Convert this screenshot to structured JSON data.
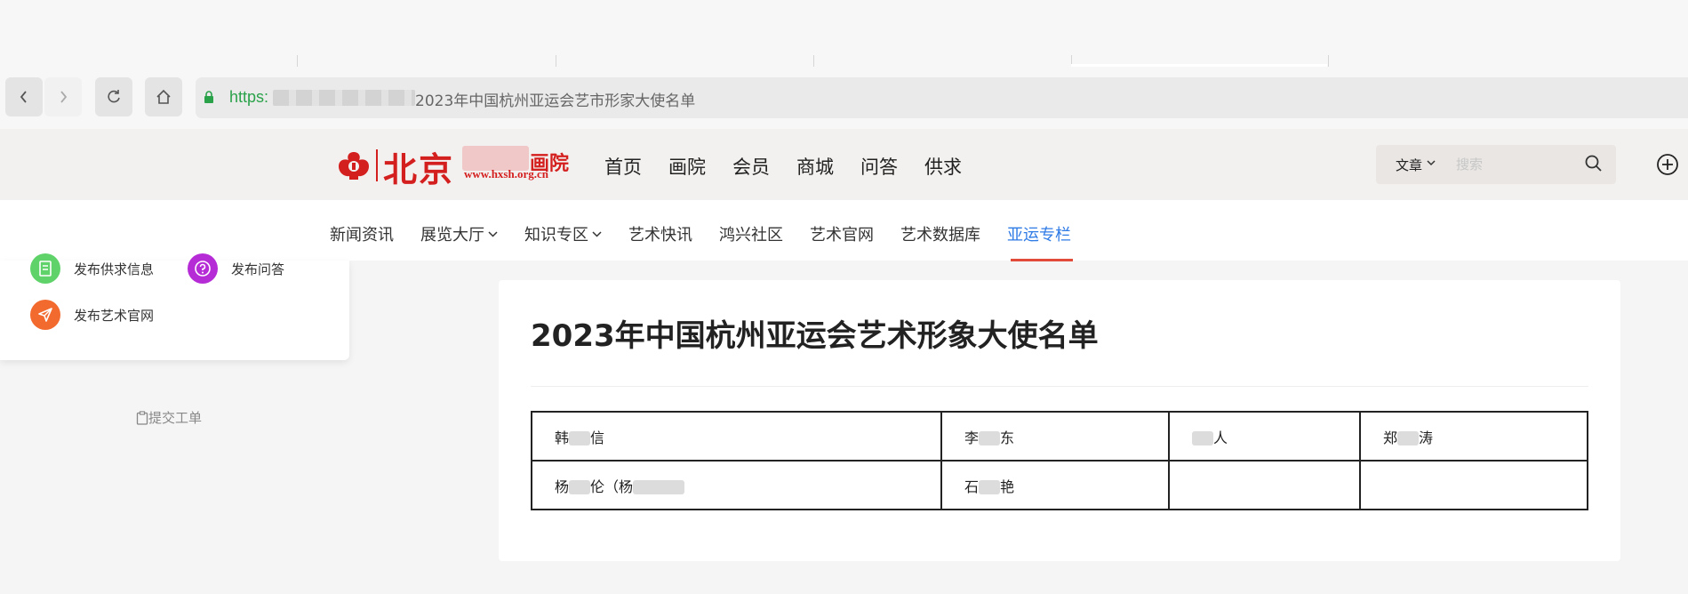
{
  "browser": {
    "url_scheme": "https:",
    "url_rest": "2023年中国杭州亚运会艺市形家大使名单",
    "back_icon": "chevron-left-icon",
    "forward_icon": "chevron-right-icon",
    "reload_icon": "reload-icon",
    "home_icon": "home-icon"
  },
  "site": {
    "logo_text": "北京",
    "logo_suffix": "画院",
    "logo_url": "www.hxsh.org.cn",
    "brand_color": "#d41f1f",
    "nav": [
      "首页",
      "画院",
      "会员",
      "商城",
      "问答",
      "供求"
    ],
    "search": {
      "type_label": "文章",
      "placeholder": "搜索"
    }
  },
  "subnav": {
    "items": [
      {
        "label": "新闻资讯",
        "has_caret": false
      },
      {
        "label": "展览大厅",
        "has_caret": true
      },
      {
        "label": "知识专区",
        "has_caret": true
      },
      {
        "label": "艺术快讯",
        "has_caret": false
      },
      {
        "label": "鸿兴社区",
        "has_caret": false
      },
      {
        "label": "艺术官网",
        "has_caret": false
      },
      {
        "label": "艺术数据库",
        "has_caret": false
      },
      {
        "label": "亚运专栏",
        "has_caret": false,
        "active": true
      }
    ],
    "active_color": "#2f7be6",
    "underline_color": "#e24b3a"
  },
  "side_panel": {
    "items": [
      {
        "label": "发布供求信息",
        "icon": "document-icon",
        "color": "#5fd36a"
      },
      {
        "label": "发布问答",
        "icon": "question-icon",
        "color": "#b52bd6"
      },
      {
        "label": "发布艺术官网",
        "icon": "send-icon",
        "color": "#f26a2e"
      }
    ],
    "submit_ticket": "提交工单"
  },
  "article": {
    "title": "2023年中国杭州亚运会艺术形象大使名单",
    "rows": [
      [
        {
          "pre": "韩",
          "post": "信"
        },
        {
          "pre": "李",
          "post": "东"
        },
        {
          "pre": "",
          "post": "人"
        },
        {
          "pre": "郑",
          "post": "涛"
        }
      ],
      [
        {
          "pre": "杨",
          "post": "伦（杨",
          "wide": true
        },
        {
          "pre": "石",
          "post": "艳"
        },
        {
          "pre": "",
          "post": ""
        },
        {
          "pre": "",
          "post": ""
        }
      ]
    ]
  }
}
